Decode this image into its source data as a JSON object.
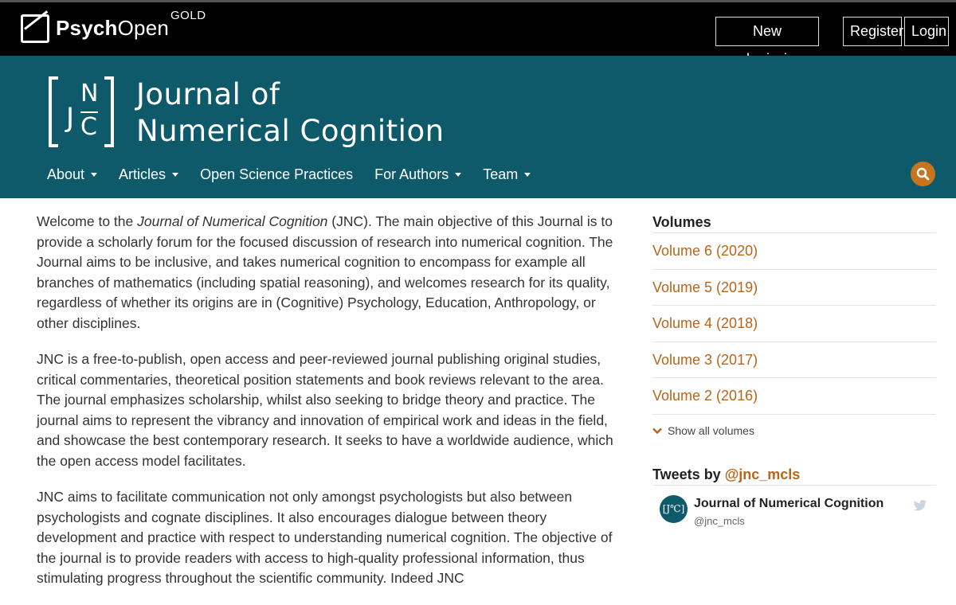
{
  "topbar": {
    "brand_bold": "Psych",
    "brand_light": "Open",
    "brand_tier": "GOLD",
    "new_submission": "New submission",
    "register": "Register",
    "login": "Login"
  },
  "header": {
    "logo_letters": {
      "j": "J",
      "n": "N",
      "c": "C"
    },
    "title_line1": "Journal of",
    "title_line2": "Numerical Cognition",
    "nav": [
      {
        "label": "About",
        "dropdown": true
      },
      {
        "label": "Articles",
        "dropdown": true
      },
      {
        "label": "Open Science Practices",
        "dropdown": false
      },
      {
        "label": "For Authors",
        "dropdown": true
      },
      {
        "label": "Team",
        "dropdown": true
      }
    ],
    "search_icon": "search-icon"
  },
  "main": {
    "p1_pre": "Welcome to the ",
    "p1_em": "Journal of Numerical Cognition",
    "p1_post": " (JNC). The main objective of this Journal is to provide a scholarly forum for the focused discussion of research into numerical cognition. The Journal aims to be inclusive, and takes numerical cognition to encompass for example all branches of mathematics (including spatial reasoning), and welcomes research for its quality, regardless of whether its origins are in (Cognitive) Psychology, Education, Anthropology, or other disciplines.",
    "p2": "JNC is a free-to-publish, open access and peer-reviewed journal publishing original studies, critical commentaries, theoretical position statements and book reviews relevant to the area. The journal emphasizes scholarship, whilst also seeking to bridge theory and practice. The journal aims to represent the vibrancy and innovation of empirical work and ideas in the field, and showcase the best contemporary research. It seeks to have a worldwide audience, which the open access model facilitates.",
    "p3": "JNC aims to facilitate communication not only amongst psychologists but also between psychologists and cognate disciplines. It also encourages dialogue between theory development and practice with respect to understanding numerical cognition. The objective of the journal is to provide readers with access to high-quality professional information, thus stimulating progress throughout the scientific community. Indeed JNC"
  },
  "sidebar": {
    "volumes_heading": "Volumes",
    "volumes": [
      "Volume 6 (2020)",
      "Volume 5 (2019)",
      "Volume 4 (2018)",
      "Volume 3 (2017)",
      "Volume 2 (2016)"
    ],
    "show_all": "Show all volumes",
    "tweets_prefix": "Tweets by ",
    "tweets_handle": "@jnc_mcls",
    "tweet_name": "Journal of Numerical Cognition",
    "tweet_user": "@jnc_mcls",
    "tweet_avatar_text": "[J℃]"
  },
  "colors": {
    "header_bg": "#0e5a6b",
    "accent": "#b8651a",
    "search_bg": "#c6741d",
    "topbar_bg": "#000000"
  }
}
